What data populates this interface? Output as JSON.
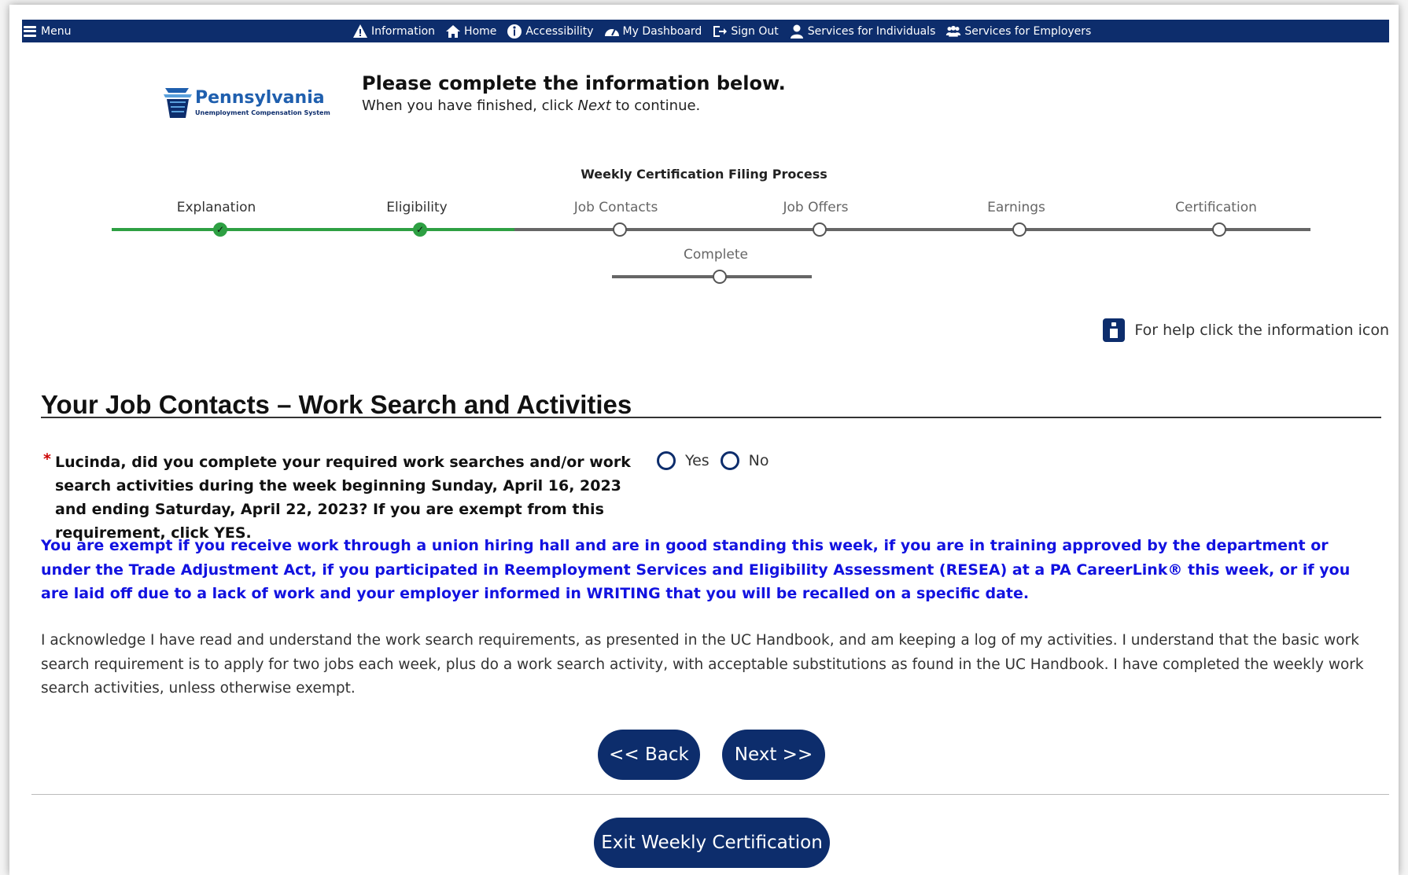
{
  "navbar": {
    "menu_label": "Menu",
    "links": [
      {
        "label": "Information",
        "icon": "warning-icon"
      },
      {
        "label": "Home",
        "icon": "home-icon"
      },
      {
        "label": "Accessibility",
        "icon": "accessibility-icon"
      },
      {
        "label": "My Dashboard",
        "icon": "dashboard-icon"
      },
      {
        "label": "Sign Out",
        "icon": "sign-out-icon"
      },
      {
        "label": "Services for Individuals",
        "icon": "user-icon"
      },
      {
        "label": "Services for Employers",
        "icon": "group-icon"
      }
    ]
  },
  "logo": {
    "name": "Pennsylvania",
    "subtitle": "Unemployment Compensation System"
  },
  "intro": {
    "title": "Please complete the information below.",
    "subtitle_prefix": "When you have finished, click ",
    "subtitle_emph": "Next",
    "subtitle_suffix": " to continue."
  },
  "process": {
    "title": "Weekly Certification Filing Process",
    "steps": [
      {
        "label": "Explanation",
        "status": "complete"
      },
      {
        "label": "Eligibility",
        "status": "complete"
      },
      {
        "label": "Job Contacts",
        "status": "incomplete"
      },
      {
        "label": "Job Offers",
        "status": "incomplete"
      },
      {
        "label": "Earnings",
        "status": "incomplete"
      },
      {
        "label": "Certification",
        "status": "incomplete"
      },
      {
        "label": "Complete",
        "status": "incomplete"
      }
    ]
  },
  "help": {
    "text": "For help click the information icon"
  },
  "section": {
    "title": "Your Job Contacts – Work Search and Activities"
  },
  "question": {
    "required_marker": "*",
    "text": "Lucinda, did you complete your required work searches and/or work search activities during the week beginning Sunday, April 16, 2023 and ending Saturday, April 22, 2023? If you are exempt from this requirement, click YES.",
    "options": [
      "Yes",
      "No"
    ]
  },
  "exempt_note": "You are exempt if you receive work through a union hiring hall and are in good standing this week, if you are in training approved by the department or under the Trade Adjustment Act, if you participated in Reemployment Services and Eligibility Assessment (RESEA) at a PA CareerLink® this week, or if you are laid off due to a lack of work and your employer informed in WRITING that you will be recalled on a specific date.",
  "acknowledgement": "I acknowledge I have read and understand the work search requirements, as presented in the UC Handbook, and am keeping a log of my activities. I understand that the basic work search requirement is to apply for two jobs each week, plus do a work search activity, with acceptable substitutions as found in the UC Handbook. I have completed the weekly work search activities, unless otherwise exempt.",
  "buttons": {
    "back": "<< Back",
    "next": "Next >>",
    "exit": "Exit Weekly Certification"
  },
  "colors": {
    "navy": "#0d2d6c",
    "progress_green": "#2ea043",
    "exempt_blue": "#1212e0",
    "required_red": "#cc0000"
  }
}
